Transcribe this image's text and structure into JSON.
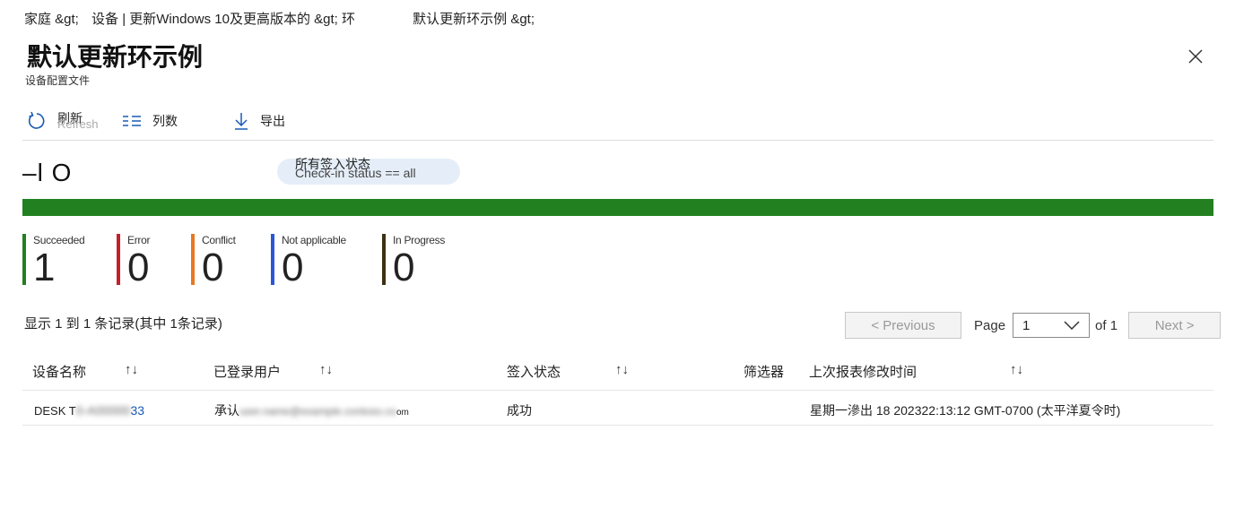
{
  "breadcrumb": {
    "items": [
      "家庭 &gt;",
      "设备 | 更新Windows 10及更高版本的 &gt; 环",
      "默认更新环示例 &gt;"
    ]
  },
  "page": {
    "title": "默认更新环示例",
    "subtitle": "设备配置文件"
  },
  "toolbar": {
    "refresh_label": "刷新",
    "refresh_shadow": "Refresh",
    "columns_label": "列数",
    "export_label": "导出"
  },
  "filter": {
    "mark": "–l O",
    "pill_label_cn": "所有签入状态",
    "pill_label_en": "Check-in status == all"
  },
  "colors": {
    "succeeded": "#228021",
    "error": "#c4202a",
    "conflict": "#e87722",
    "not_applicable": "#2b56d8",
    "in_progress": "#3d3012"
  },
  "stats": [
    {
      "label": "Succeeded",
      "value": "1"
    },
    {
      "label": "Error",
      "value": "0"
    },
    {
      "label": "Conflict",
      "value": "0"
    },
    {
      "label": "Not applicable",
      "value": "0"
    },
    {
      "label": "In Progress",
      "value": "0"
    }
  ],
  "progress": {
    "succeeded_fraction": 1.0
  },
  "records": {
    "summary": "显示 1 到 1 条记录(其中 1条记录)"
  },
  "pager": {
    "previous_label": "< Previous",
    "page_label": "Page",
    "page_value": "1",
    "of_label": "of 1",
    "next_label": "Next >"
  },
  "table": {
    "columns": [
      "设备名称",
      "已登录用户",
      "签入状态",
      "筛选器",
      "上次报表修改时间"
    ],
    "sort_icon": "↑↓",
    "rows": [
      {
        "device_prefix": "DESK T",
        "device_hidden": "0-A00000",
        "device_suffix": "33",
        "user_prefix": "承认",
        "user_hidden": "user.name@example.contoso.co",
        "user_suffix": "om",
        "status": "成功",
        "filter": "",
        "last_report": "星期一滲出 18 202322:13:12 GMT-0700 (太平洋夏令时)"
      }
    ]
  }
}
